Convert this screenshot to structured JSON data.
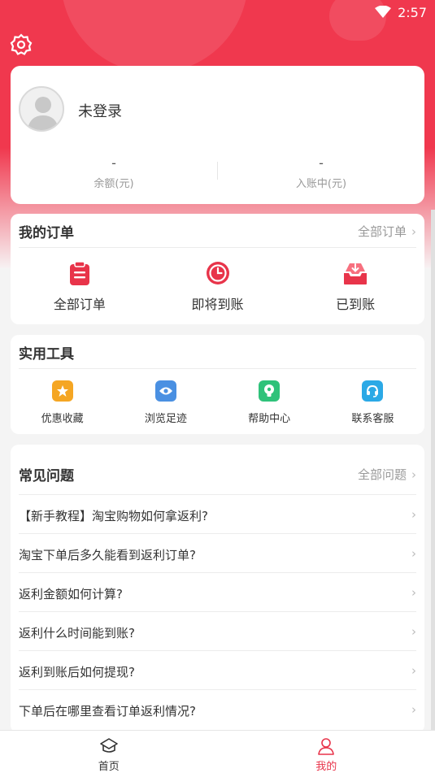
{
  "status": {
    "time": "2:57",
    "wifi_icon": "wifi-icon"
  },
  "header": {
    "settings_icon": "gear-icon"
  },
  "user": {
    "name": "未登录",
    "avatar_icon": "avatar-placeholder-icon",
    "stats": [
      {
        "value": "-",
        "label": "余额(元)"
      },
      {
        "value": "-",
        "label": "入账中(元)"
      }
    ]
  },
  "orders": {
    "title": "我的订单",
    "more": "全部订单",
    "items": [
      {
        "label": "全部订单",
        "icon": "clipboard-icon"
      },
      {
        "label": "即将到账",
        "icon": "clock-icon"
      },
      {
        "label": "已到账",
        "icon": "inbox-icon"
      }
    ]
  },
  "tools": {
    "title": "实用工具",
    "items": [
      {
        "label": "优惠收藏",
        "icon": "star-icon",
        "color": "#f5a623"
      },
      {
        "label": "浏览足迹",
        "icon": "eye-icon",
        "color": "#4a90e2"
      },
      {
        "label": "帮助中心",
        "icon": "lightbulb-icon",
        "color": "#2fc27a"
      },
      {
        "label": "联系客服",
        "icon": "headset-icon",
        "color": "#2ba9e6"
      }
    ]
  },
  "faq": {
    "title": "常见问题",
    "more": "全部问题",
    "items": [
      "【新手教程】淘宝购物如何拿返利?",
      "淘宝下单后多久能看到返利订单?",
      "返利金额如何计算?",
      "返利什么时间能到账?",
      "返利到账后如何提现?",
      "下单后在哪里查看订单返利情况?"
    ]
  },
  "tabbar": {
    "items": [
      {
        "label": "首页",
        "icon": "home-icon",
        "active": false
      },
      {
        "label": "我的",
        "icon": "profile-icon",
        "active": true
      }
    ]
  },
  "colors": {
    "brand": "#f0384e",
    "accent": "#e8344a"
  }
}
